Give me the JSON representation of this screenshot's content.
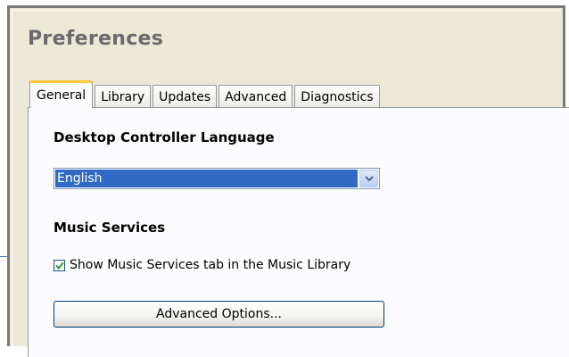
{
  "window": {
    "title": "Preferences"
  },
  "tabs": [
    {
      "label": "General",
      "active": true
    },
    {
      "label": "Library",
      "active": false
    },
    {
      "label": "Updates",
      "active": false
    },
    {
      "label": "Advanced",
      "active": false
    },
    {
      "label": "Diagnostics",
      "active": false
    }
  ],
  "general": {
    "language_heading": "Desktop Controller Language",
    "language_selected": "English",
    "music_services_heading": "Music Services",
    "show_music_services_checkbox": {
      "label": "Show Music Services tab in the Music Library",
      "checked": true
    },
    "advanced_options_button": "Advanced Options..."
  },
  "icons": {
    "dropdown_arrow": "chevron-down-icon",
    "checkmark": "checkmark-icon"
  },
  "colors": {
    "selection_highlight": "#316ac5",
    "active_tab_accent": "#ffc73c",
    "checkmark_green": "#21a121"
  }
}
